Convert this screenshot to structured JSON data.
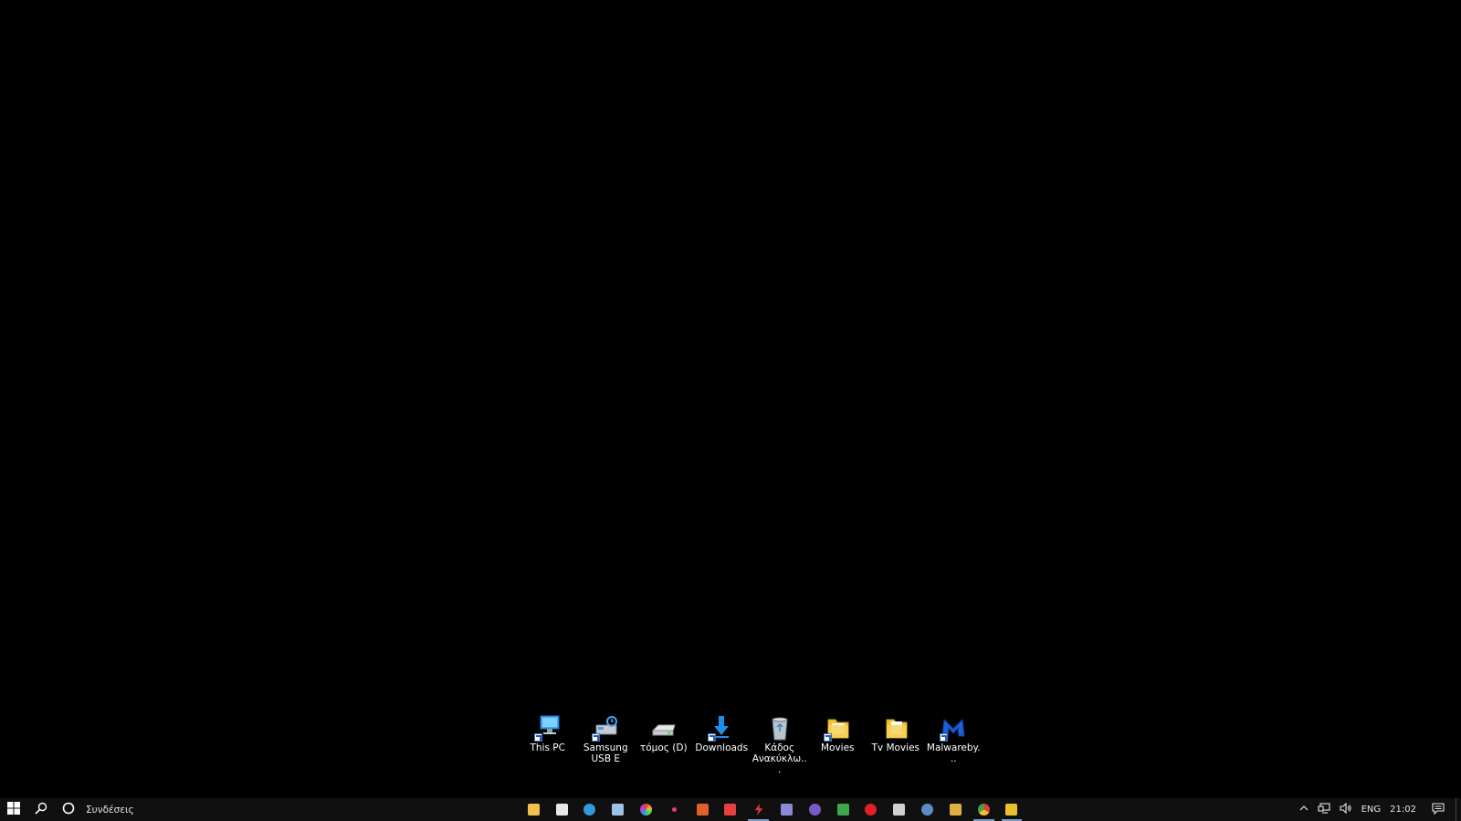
{
  "desktop": {
    "background": "#000000",
    "icons": [
      {
        "label": "This PC",
        "icon": "this-pc-icon"
      },
      {
        "label": "Samsung USB E",
        "icon": "usb-drive-icon"
      },
      {
        "label": "τόμος (D)",
        "icon": "drive-icon"
      },
      {
        "label": "Downloads",
        "icon": "downloads-icon"
      },
      {
        "label": "Κάδος Ανακύκλω...",
        "icon": "recycle-bin-icon"
      },
      {
        "label": "Movies",
        "icon": "folder-icon"
      },
      {
        "label": "Tv Movies",
        "icon": "folder-icon"
      },
      {
        "label": "Malwareby...",
        "icon": "malwarebytes-icon"
      }
    ]
  },
  "taskbar": {
    "search_label": "Συνδέσεις",
    "apps": [
      {
        "icon": "file-explorer-icon",
        "color": "#f2c14e"
      },
      {
        "icon": "store-icon",
        "color": "#e8e8e8"
      },
      {
        "icon": "edge-icon",
        "color": "#2f9bd8"
      },
      {
        "icon": "mail-icon",
        "color": "#9cc3e6"
      },
      {
        "icon": "color-wheel-icon",
        "color": "#c040d0"
      },
      {
        "icon": "dot-app-icon",
        "color": "#e03c8a"
      },
      {
        "icon": "game-app-icon",
        "color": "#e0602a"
      },
      {
        "icon": "popcorn-icon",
        "color": "#e84040"
      },
      {
        "icon": "flash-icon",
        "color": "#e83b3b"
      },
      {
        "icon": "screen-app-icon",
        "color": "#8a8ad8"
      },
      {
        "icon": "viber-icon",
        "color": "#7b58c8"
      },
      {
        "icon": "grid-app-icon",
        "color": "#3fa84a"
      },
      {
        "icon": "red-dot-app-icon",
        "color": "#e21f26"
      },
      {
        "icon": "epic-games-icon",
        "color": "#d0d0d0"
      },
      {
        "icon": "steam-icon",
        "color": "#5a8dc8"
      },
      {
        "icon": "folder-app-icon",
        "color": "#e0b040"
      },
      {
        "icon": "chrome-icon",
        "color": "#3fa34d"
      },
      {
        "icon": "yellow-app-icon",
        "color": "#e8c030"
      }
    ],
    "tray": {
      "language": "ENG",
      "time": "21:02"
    }
  }
}
